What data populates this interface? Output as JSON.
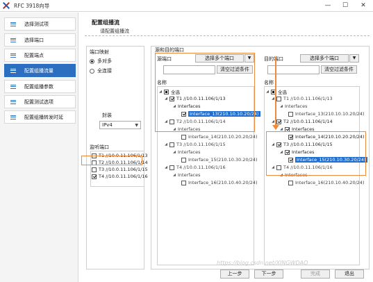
{
  "window": {
    "title": "RFC 3918向导",
    "minimize": "—",
    "maximize": "☐",
    "close": "✕"
  },
  "sidebar": {
    "items": [
      {
        "label": "选择测试项",
        "active": false
      },
      {
        "label": "选择端口",
        "active": false
      },
      {
        "label": "配置端点",
        "active": false
      },
      {
        "label": "配置组播流量",
        "active": true
      },
      {
        "label": "配置组播参数",
        "active": false
      },
      {
        "label": "配置测试选项",
        "active": false
      },
      {
        "label": "配置组播转发时延",
        "active": false
      }
    ]
  },
  "header": {
    "title": "配置组播流",
    "subtitle": "请配置组播流"
  },
  "left_panel": {
    "mapping_label": "端口映射",
    "options": [
      {
        "label": "多对多",
        "selected": true
      },
      {
        "label": "全连接",
        "selected": false
      }
    ],
    "encap_label": "封装",
    "encap_value": "IPv4",
    "monitor_label": "监听端口",
    "monitor_ports": [
      {
        "label": "T1 //10.0.11.106/1/13",
        "checked": false
      },
      {
        "label": "T2 //10.0.11.106/1/14",
        "checked": false
      },
      {
        "label": "T3 //10.0.11.106/1/15",
        "checked": false
      },
      {
        "label": "T4 //10.0.11.106/1/16",
        "checked": true
      }
    ]
  },
  "ports_frame": {
    "label": "源和目的端口"
  },
  "source": {
    "label": "源端口",
    "select_multi": "选择多个端口",
    "clear_filter": "清空过滤条件",
    "name_header": "名称",
    "root": "全选",
    "nodes": [
      {
        "port": "T1 //10.0.11.106/1/13",
        "port_checked": true,
        "iface_group": "Interfaces",
        "iface": "Interface_13(210.10.10.20/24)",
        "iface_checked": true
      },
      {
        "port": "T2 //10.0.11.106/1/14",
        "port_checked": false,
        "iface_group": "Interfaces",
        "iface": "Interface_14(210.10.20.20/24)",
        "iface_checked": false
      },
      {
        "port": "T3 //10.0.11.106/1/15",
        "port_checked": false,
        "iface_group": "Interfaces",
        "iface": "Interface_15(210.10.30.20/24)",
        "iface_checked": false
      },
      {
        "port": "T4 //10.0.11.106/1/16",
        "port_checked": false,
        "iface_group": "Interfaces",
        "iface": "Interface_16(210.10.40.20/24)",
        "iface_checked": false
      }
    ]
  },
  "dest": {
    "label": "目的端口",
    "select_multi": "选择多个端口",
    "clear_filter": "清空过滤条件",
    "name_header": "名称",
    "root": "全选",
    "nodes": [
      {
        "port": "T1 //10.0.11.106/1/13",
        "port_checked": false,
        "iface_group": "Interfaces",
        "iface": "Interface_13(210.10.10.20/24)",
        "iface_checked": false
      },
      {
        "port": "T2 //10.0.11.106/1/14",
        "port_checked": true,
        "iface_group": "Interfaces",
        "iface": "Interface_14(210.10.20.20/24)",
        "iface_checked": true
      },
      {
        "port": "T3 //10.0.11.106/1/15",
        "port_checked": true,
        "iface_group": "Interfaces",
        "iface": "Interface_15(210.10.30.20/24)",
        "iface_checked": true
      },
      {
        "port": "T4 //10.0.11.106/1/16",
        "port_checked": false,
        "iface_group": "Interfaces",
        "iface": "Interface_16(210.10.40.20/24)",
        "iface_checked": false
      }
    ]
  },
  "footer": {
    "prev": "上一步",
    "next": "下一步",
    "finish": "完成",
    "exit": "退出"
  },
  "watermark": "https://blog.csdn.net/XINGWDAO",
  "colors": {
    "accent": "#2c6ebf",
    "highlight": "#ee8a3a",
    "selection": "#1f6fd1"
  }
}
